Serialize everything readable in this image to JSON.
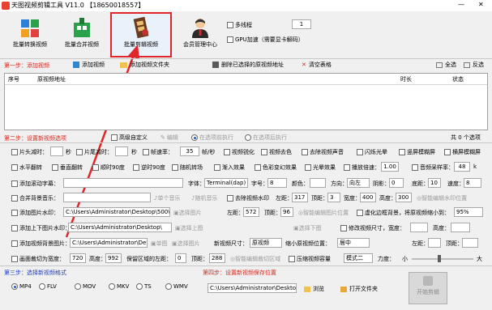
{
  "window": {
    "title": "天图视频剪辑工具 V11.0 【18650018557】",
    "minimize": "—",
    "close": "✕"
  },
  "toolbar": {
    "buttons": [
      {
        "label": "批量转换视频"
      },
      {
        "label": "批量合并视频"
      },
      {
        "label": "批量剪辑视频"
      },
      {
        "label": "会员管理中心"
      }
    ],
    "multithread_label": "多线程",
    "multithread_value": "1",
    "gpu_label": "GPU加速（需要显卡解码）"
  },
  "step1": {
    "title": "第一步：添加视频",
    "add_video": "添加视频",
    "add_folder": "添加视频文件夹",
    "delete_selected": "删除已选择的原视频地址",
    "clear_table": "清空表格",
    "select_all": "全选",
    "invert": "反选"
  },
  "table": {
    "col_index": "序号",
    "col_path": "原视频地址",
    "col_duration": "时长",
    "col_status": "状态"
  },
  "step2": {
    "title": "第二步：设置新视频选项",
    "advanced_custom": "高级自定义",
    "edit": "编辑",
    "exec_in_order": "在选项前执行",
    "exec_after": "在选项后执行",
    "page_info": "共 0 个选项"
  },
  "options": {
    "r1": {
      "head_cut": "片头减时：",
      "head_val": "",
      "sec1": "秒",
      "tail_cut": "片尾减时：",
      "tail_val": "",
      "sec2": "秒",
      "fps_label": "帧速率：",
      "fps_val": "35",
      "fps_unit": "帧/秒",
      "sharpen": "视频锐化",
      "fade": "视频去色",
      "remove_audio": "去除视频声音",
      "flash": "闪烁光晕",
      "vertical_blur": "竖屏模糊屏",
      "horizontal_blur": "横屏模糊屏"
    },
    "r2": {
      "hflip": "水平翻转",
      "vflip": "垂直翻转",
      "rot90": "顺时90度",
      "rot_ccw": "逆时90度",
      "random_rotate": "随机转场",
      "fade_in": "渐入效果",
      "color_transform": "色彩变幻效果",
      "light_effect": "光晕效果",
      "speed_label": "播放倍速：",
      "speed_val": "1.00",
      "sample_label": "音频采样率：",
      "sample_val": "48",
      "sample_unit": "k"
    },
    "r3": {
      "add_subtitle": "添加滚动字幕：",
      "font_label": "字体：",
      "font_val": "Terminal(dap)",
      "size_label": "字号：",
      "size_val": "8",
      "color_label": "颜色：",
      "dir_label": "方向：",
      "dir_val": "向左",
      "shadow_label": "阴影：",
      "shadow_val": "0",
      "bottom_label": "底距：",
      "bottom_val": "10",
      "speed_label": "速度：",
      "speed_val": "8"
    },
    "r4": {
      "merge_audio": "合并背景音乐：",
      "single_audio": "单个音乐",
      "random_audio": "随机音乐",
      "remove_watermark": "去除视频水印",
      "left_label": "左距：",
      "left_val": "317",
      "top_label": "顶距：",
      "top_val": "3",
      "width_label": "宽度：",
      "width_val": "400",
      "height_label": "高度：",
      "height_val": "300",
      "smart_watermark": "智能编辑水印位置"
    },
    "r5": {
      "add_image_watermark": "添加图片水印：",
      "path_val": "C:\\Users\\Administrator\\Desktop\\500\\",
      "select_image": "选择图片",
      "left_label": "左距：",
      "left_val": "572",
      "top_label": "顶距：",
      "top_val": "96",
      "smart_pos": "智能编辑图片位置",
      "virtual_bg": "虚化边框背景，将原视频缩小到：",
      "shrink_val": "95%"
    },
    "r6": {
      "add_top_bottom": "添加上下图片水印：",
      "path_val": "C:\\Users\\Administrator\\Desktop\\",
      "select_top": "选择上图",
      "select_bottom": "选择下图",
      "modify_size": "修改视频尺寸，宽度：",
      "w_val": "",
      "height_label": "高度：",
      "h_val": ""
    },
    "r7": {
      "add_bg_image": "添加视频背景图片：",
      "path_val": "C:\\Users\\Administrator\\Desktop\\",
      "single_image": "单图",
      "select_image": "选择图片",
      "new_size": "新视频尺寸：",
      "size_val": "原视频",
      "shrink_pos": "缩小原视频位置：",
      "pos_val": "居中",
      "left_label": "左距：",
      "top_label": "顶距：",
      "left_val": "",
      "top_val": ""
    },
    "r8": {
      "crop": "画面裁切为宽度：",
      "crop_w": "720",
      "crop_h_label": "高度：",
      "crop_h": "992",
      "keep_left": "保留区域的左距：",
      "keep_left_val": "0",
      "keep_top_label": "顶距：",
      "keep_top_val": "288",
      "smart_crop": "智能编辑裁切区域",
      "compress": "压缩视频容量",
      "mode_val": "模式二",
      "quality_label": "力度：",
      "small": "小",
      "big": "大"
    }
  },
  "step3": {
    "title": "第三步：选择新视频格式",
    "formats": [
      "MP4",
      "FLV",
      "MOV",
      "MKV",
      "TS",
      "WMV"
    ],
    "selected": "MP4"
  },
  "step4": {
    "title": "第四步：设置新视频保存位置",
    "path_val": "C:\\Users\\Administrator\\Desktop\\",
    "browse": "浏览",
    "open_folder": "打开文件夹",
    "start": "开始剪辑"
  },
  "colors": {
    "accent_red": "#d6281f",
    "accent_blue": "#1f3fbf",
    "selection_border": "#e0262a"
  }
}
